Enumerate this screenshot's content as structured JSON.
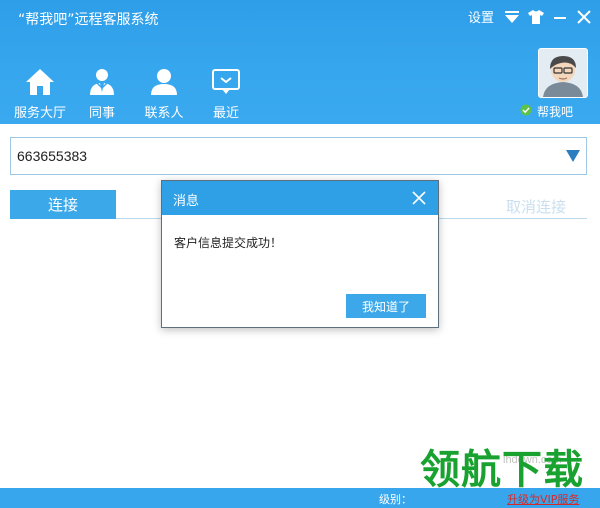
{
  "window": {
    "title": "“帮我吧”远程客服系统",
    "settings_label": "设置"
  },
  "nav": {
    "items": [
      {
        "label": "服务大厅",
        "icon": "home-icon"
      },
      {
        "label": "同事",
        "icon": "colleague-icon"
      },
      {
        "label": "联系人",
        "icon": "contact-icon"
      },
      {
        "label": "最近",
        "icon": "recent-chat-icon"
      }
    ]
  },
  "profile": {
    "brand_label": "帮我吧"
  },
  "connect": {
    "id_value": "663655383",
    "connect_label": "连接",
    "cancel_label": "取消连接"
  },
  "dialog": {
    "title": "消息",
    "message": "客户信息提交成功！",
    "ok_label": "我知道了"
  },
  "statusbar": {
    "level_label": "级别：",
    "vip_label": "升级为VIP服务"
  },
  "watermark": {
    "url": "lhdown.com",
    "text": "领航下载"
  },
  "colors": {
    "header": "#36a6ee",
    "accent": "#3ba8ea",
    "vip": "#d62a2a",
    "watermark": "#1aa231"
  }
}
